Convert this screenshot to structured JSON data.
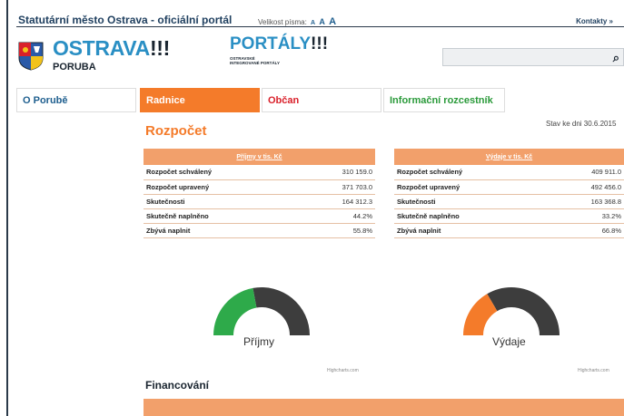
{
  "header": {
    "site_title": "Statutární město Ostrava - oficiální portál",
    "font_size_label": "Velikost písma:",
    "font_size_options": [
      "A",
      "A",
      "A"
    ],
    "contacts_label": "Kontakty »"
  },
  "logo": {
    "word": "OSTRAVA",
    "bang": "!!!",
    "sub": "PORUBA"
  },
  "portal": {
    "title": "PORTÁLY",
    "bang": "!!!",
    "sub": "OSTRAVSKÉ INTEGROVANÉ PORTÁLY"
  },
  "search": {
    "placeholder": "",
    "icon": "search-icon"
  },
  "nav": {
    "items": [
      {
        "label": "O Porubě"
      },
      {
        "label": "Radnice"
      },
      {
        "label": "Občan"
      },
      {
        "label": "Informační rozcestník"
      }
    ]
  },
  "page": {
    "title": "Rozpočet",
    "status": "Stav ke dni 30.6.2015"
  },
  "income": {
    "header": "Příjmy v tis. Kč",
    "rows": [
      {
        "label": "Rozpočet schválený",
        "value": "310 159.0"
      },
      {
        "label": "Rozpočet upravený",
        "value": "371 703.0"
      },
      {
        "label": "Skutečnosti",
        "value": "164 312.3"
      },
      {
        "label": "Skutečně naplněno",
        "value": "44.2%"
      },
      {
        "label": "Zbývá naplnit",
        "value": "55.8%"
      }
    ]
  },
  "expense": {
    "header": "Výdaje v tis. Kč",
    "rows": [
      {
        "label": "Rozpočet schválený",
        "value": "409 911.0"
      },
      {
        "label": "Rozpočet upravený",
        "value": "492 456.0"
      },
      {
        "label": "Skutečnosti",
        "value": "163 368.8"
      },
      {
        "label": "Skutečně naplněno",
        "value": "33.2%"
      },
      {
        "label": "Zbývá naplnit",
        "value": "66.8%"
      }
    ]
  },
  "gauges": {
    "income_label": "Příjmy",
    "income_fill": 0.442,
    "income_color": "#2eaa4a",
    "expense_label": "Výdaje",
    "expense_fill": 0.332,
    "expense_color": "#f47b2a",
    "track_color": "#3d3d3d",
    "credit": "Highcharts.com"
  },
  "financing": {
    "title": "Financování"
  },
  "colors": {
    "accent": "#f47b2a",
    "brand_blue": "#2a8fc4",
    "navy": "#1f3f5f"
  }
}
